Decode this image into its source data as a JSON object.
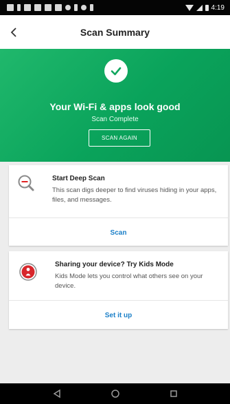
{
  "status_bar": {
    "time": "4:19",
    "notification_icons": [
      "notification-icon",
      "notification-icon",
      "mail-icon",
      "mail-icon",
      "shield-icon",
      "shield-icon",
      "dot-icon",
      "clipboard-icon",
      "dot-icon",
      "download-icon"
    ]
  },
  "app_bar": {
    "title": "Scan Summary",
    "back_icon": "back-arrow-icon"
  },
  "hero": {
    "title": "Your Wi-Fi & apps look good",
    "subtitle": "Scan Complete",
    "button_label": "SCAN AGAIN",
    "icon": "checkmark-icon",
    "colors": {
      "gradient_start": "#20b86c",
      "gradient_end": "#089552",
      "check": "#11a65e"
    }
  },
  "cards": [
    {
      "title": "Start Deep Scan",
      "description": "This scan digs deeper to find viruses hiding in your apps, files, and messages.",
      "action": "Scan",
      "icon": "magnifier-scan-icon"
    },
    {
      "title": "Sharing your device? Try Kids Mode",
      "description": "Kids Mode lets you control what others see on your device.",
      "action": "Set it up",
      "icon": "kids-mode-icon"
    }
  ],
  "nav_bar": {
    "buttons": [
      "back-triangle-icon",
      "home-circle-icon",
      "recents-square-icon"
    ]
  },
  "colors": {
    "accent": "#1a7fc8",
    "background": "#ededed"
  }
}
